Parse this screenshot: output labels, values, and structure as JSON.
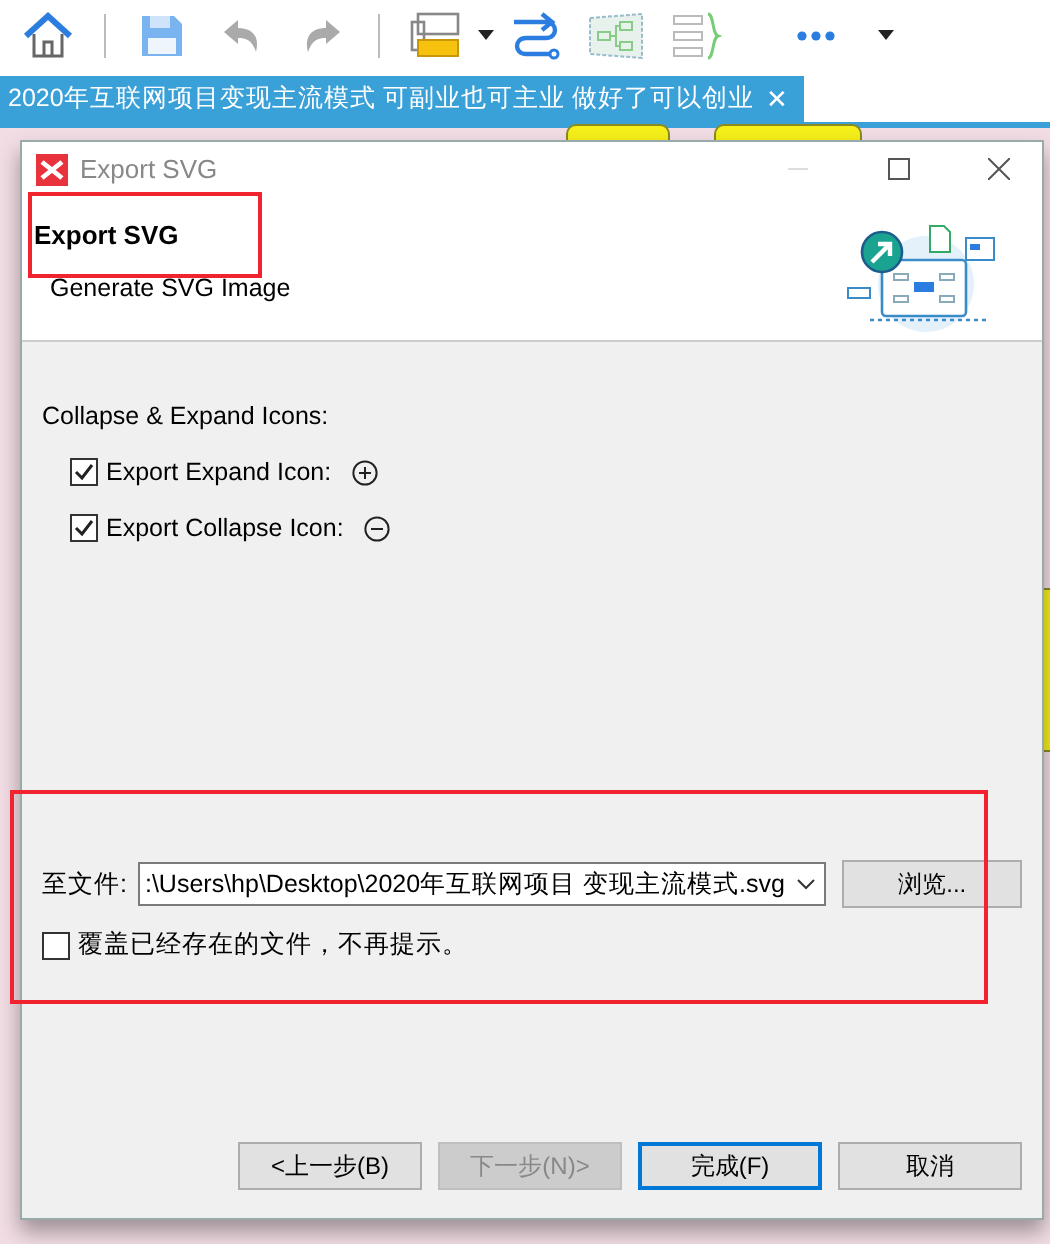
{
  "document_tab": {
    "title": "2020年互联网项目变现主流模式 可副业也可主业 做好了可以创业",
    "close": "✕"
  },
  "dialog": {
    "title": "Export SVG",
    "heading": "Export SVG",
    "subtitle": "Generate SVG Image",
    "section_heading": "Collapse & Expand Icons:",
    "options": [
      {
        "label": "Export Expand Icon:",
        "checked": true,
        "kind": "expand"
      },
      {
        "label": "Export Collapse Icon:",
        "checked": true,
        "kind": "collapse"
      }
    ],
    "file": {
      "label": "至文件:",
      "value": ":\\Users\\hp\\Desktop\\2020年互联网项目 变现主流模式.svg",
      "browse": "浏览..."
    },
    "overwrite": {
      "label": "覆盖已经存在的文件，不再提示。",
      "checked": false
    },
    "buttons": [
      {
        "label": "<上一步(B)",
        "disabled": false,
        "focused": false
      },
      {
        "label": "下一步(N)>",
        "disabled": true,
        "focused": false
      },
      {
        "label": "完成(F)",
        "disabled": false,
        "focused": true
      },
      {
        "label": "取消",
        "disabled": false,
        "focused": false
      }
    ]
  }
}
